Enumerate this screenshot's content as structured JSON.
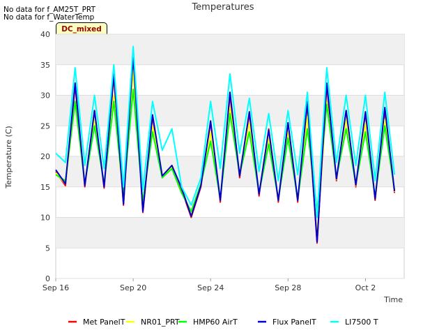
{
  "notes": [
    "No data for f_AM25T_PRT",
    "No data for f_WaterTemp"
  ],
  "badge": "DC_mixed",
  "chart_data": {
    "type": "line",
    "title": "Temperatures",
    "xlabel": "Time",
    "ylabel": "Temperature (C)",
    "xlim": [
      "2023-09-16",
      "2023-10-04"
    ],
    "ylim": [
      0,
      40
    ],
    "x_ticks": [
      "Sep 16",
      "Sep 20",
      "Sep 24",
      "Sep 28",
      "Oct 2"
    ],
    "y_ticks": [
      0,
      5,
      10,
      15,
      20,
      25,
      30,
      35,
      40
    ],
    "grid": true,
    "legend_position": "bottom",
    "x": [
      "2023-09-16 00:00",
      "2023-09-16 12:00",
      "2023-09-17 00:00",
      "2023-09-17 12:00",
      "2023-09-18 00:00",
      "2023-09-18 12:00",
      "2023-09-19 00:00",
      "2023-09-19 12:00",
      "2023-09-20 00:00",
      "2023-09-20 12:00",
      "2023-09-21 00:00",
      "2023-09-21 12:00",
      "2023-09-22 00:00",
      "2023-09-22 12:00",
      "2023-09-23 00:00",
      "2023-09-23 12:00",
      "2023-09-24 00:00",
      "2023-09-24 12:00",
      "2023-09-25 00:00",
      "2023-09-25 12:00",
      "2023-09-26 00:00",
      "2023-09-26 12:00",
      "2023-09-27 00:00",
      "2023-09-27 12:00",
      "2023-09-28 00:00",
      "2023-09-28 12:00",
      "2023-09-29 00:00",
      "2023-09-29 12:00",
      "2023-09-30 00:00",
      "2023-09-30 12:00",
      "2023-10-01 00:00",
      "2023-10-01 12:00",
      "2023-10-02 00:00",
      "2023-10-02 12:00",
      "2023-10-03 00:00",
      "2023-10-03 12:00"
    ],
    "series": [
      {
        "name": "Met PanelT",
        "color": "#ff0000",
        "values": [
          17.5,
          15.2,
          31.5,
          15.0,
          27.5,
          14.8,
          33.0,
          12.0,
          36.5,
          10.8,
          26.5,
          16.5,
          18.5,
          14.5,
          10.0,
          15.0,
          25.5,
          12.5,
          30.0,
          16.5,
          27.0,
          13.5,
          24.5,
          12.5,
          25.5,
          12.5,
          28.5,
          5.8,
          31.5,
          16.0,
          27.5,
          15.0,
          27.0,
          12.8,
          27.5,
          14.0
        ]
      },
      {
        "name": "NR01_PRT",
        "color": "#ffff00",
        "values": [
          17.3,
          15.5,
          29.0,
          15.3,
          26.0,
          15.2,
          30.0,
          12.5,
          34.0,
          11.5,
          25.0,
          16.8,
          18.3,
          14.8,
          10.5,
          15.2,
          24.0,
          12.8,
          28.0,
          16.8,
          25.5,
          13.8,
          23.0,
          12.8,
          24.0,
          12.8,
          26.5,
          7.0,
          29.0,
          16.2,
          26.0,
          15.2,
          25.5,
          13.0,
          26.0,
          14.2
        ]
      },
      {
        "name": "HMP60 AirT",
        "color": "#00ff00",
        "values": [
          17.0,
          16.0,
          29.0,
          15.5,
          25.0,
          15.5,
          29.0,
          13.5,
          31.0,
          12.5,
          24.0,
          16.5,
          18.0,
          14.0,
          11.0,
          15.5,
          22.5,
          13.0,
          27.0,
          17.0,
          24.0,
          14.0,
          22.0,
          13.0,
          23.0,
          13.0,
          24.5,
          11.0,
          28.5,
          16.5,
          24.5,
          15.5,
          24.0,
          13.5,
          25.0,
          14.5
        ]
      },
      {
        "name": "Flux PanelT",
        "color": "#0000cc",
        "values": [
          17.8,
          15.5,
          32.0,
          15.2,
          27.5,
          15.0,
          33.5,
          12.2,
          36.5,
          11.0,
          26.8,
          16.8,
          18.5,
          14.8,
          10.2,
          15.2,
          25.8,
          12.8,
          30.5,
          16.8,
          27.3,
          13.8,
          24.3,
          12.8,
          25.5,
          12.8,
          29.0,
          6.0,
          32.0,
          16.3,
          27.5,
          15.3,
          27.3,
          13.0,
          28.0,
          14.3
        ]
      },
      {
        "name": "LI7500 T",
        "color": "#00ffff",
        "values": [
          20.5,
          19.0,
          34.5,
          18.5,
          30.0,
          18.0,
          35.0,
          15.0,
          38.0,
          14.5,
          29.0,
          21.0,
          24.5,
          15.0,
          12.0,
          16.5,
          29.0,
          18.0,
          33.5,
          20.5,
          29.5,
          17.5,
          27.0,
          16.0,
          27.5,
          17.0,
          30.5,
          10.0,
          34.5,
          19.0,
          30.0,
          18.5,
          30.0,
          16.0,
          30.5,
          17.0
        ]
      }
    ]
  }
}
